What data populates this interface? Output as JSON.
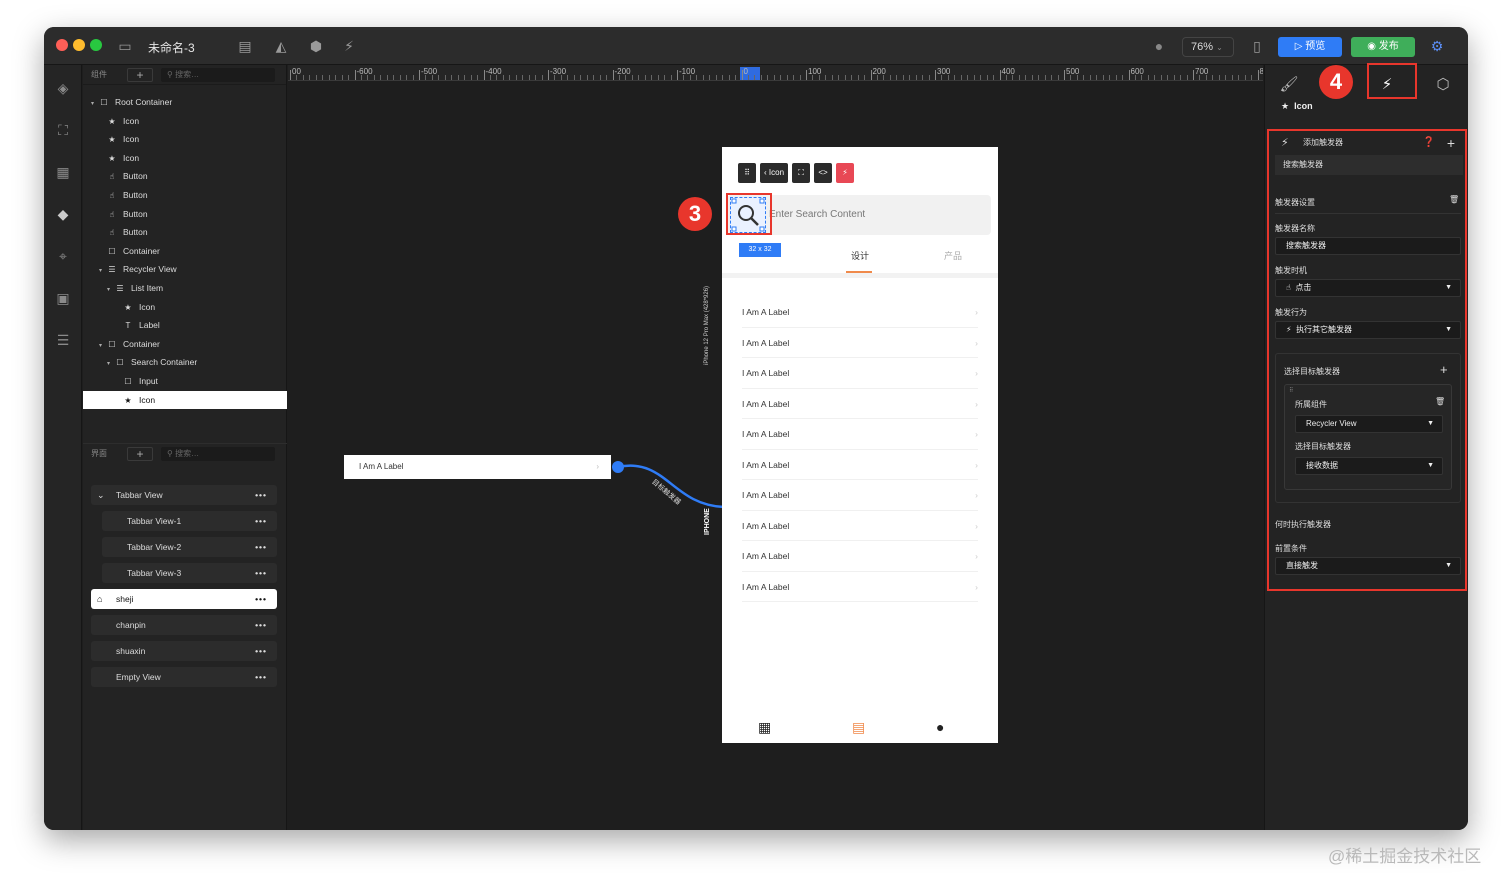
{
  "window": {
    "doc_title": "未命名-3",
    "zoom": "76%",
    "preview_label": "预览",
    "publish_label": "发布"
  },
  "layers_panel": {
    "section_label": "组件",
    "search_placeholder": "搜索",
    "tree": [
      {
        "label": "Root Container",
        "icon": "square-icon",
        "indent": 0,
        "caret": true
      },
      {
        "label": "Icon",
        "icon": "star-icon",
        "indent": 1
      },
      {
        "label": "Icon",
        "icon": "star-icon",
        "indent": 1
      },
      {
        "label": "Icon",
        "icon": "star-icon",
        "indent": 1
      },
      {
        "label": "Button",
        "icon": "hand-icon",
        "indent": 1
      },
      {
        "label": "Button",
        "icon": "hand-icon",
        "indent": 1
      },
      {
        "label": "Button",
        "icon": "hand-icon",
        "indent": 1
      },
      {
        "label": "Button",
        "icon": "hand-icon",
        "indent": 1
      },
      {
        "label": "Container",
        "icon": "square-icon",
        "indent": 1
      },
      {
        "label": "Recycler View",
        "icon": "list-icon",
        "indent": 1,
        "caret": true
      },
      {
        "label": "List Item",
        "icon": "list-icon",
        "indent": 2,
        "caret": true
      },
      {
        "label": "Icon",
        "icon": "star-icon",
        "indent": 3
      },
      {
        "label": "Label",
        "icon": "text-icon",
        "indent": 3
      },
      {
        "label": "Container",
        "icon": "square-icon",
        "indent": 1,
        "caret": true
      },
      {
        "label": "Search Container",
        "icon": "square-icon",
        "indent": 2,
        "caret": true
      },
      {
        "label": "Input",
        "icon": "square-icon",
        "indent": 3
      },
      {
        "label": "Icon",
        "icon": "star-icon",
        "indent": 3,
        "selected": true
      }
    ]
  },
  "pages_panel": {
    "section_label": "界面",
    "search_placeholder": "搜索",
    "items": [
      {
        "label": "Tabbar View",
        "type": "group"
      },
      {
        "label": "Tabbar View-1",
        "type": "sub"
      },
      {
        "label": "Tabbar View-2",
        "type": "sub"
      },
      {
        "label": "Tabbar View-3",
        "type": "sub"
      },
      {
        "label": "sheji",
        "type": "active"
      },
      {
        "label": "chanpin",
        "type": "page"
      },
      {
        "label": "shuaxin",
        "type": "page"
      },
      {
        "label": "Empty View",
        "type": "page"
      }
    ]
  },
  "ruler": {
    "labels": [
      "00",
      "-600",
      "-500",
      "-400",
      "-300",
      "-200",
      "-100",
      "0",
      "100",
      "200",
      "300",
      "400",
      "500",
      "600",
      "700",
      "800"
    ]
  },
  "canvas": {
    "external_label": "I Am A Label",
    "connector_label": "目标触发器",
    "device_name": "iPhone 12 Pro Max (428*926)",
    "device_short": "IPHONE",
    "phone": {
      "toolbar_icon_label": "Icon",
      "search_placeholder": "Enter Search Content",
      "size_badge": "32 x 32",
      "tab_design": "设计",
      "tab_product": "产品",
      "list_items": [
        "I Am A Label",
        "I Am A Label",
        "I Am A Label",
        "I Am A Label",
        "I Am A Label",
        "I Am A Label",
        "I Am A Label",
        "I Am A Label",
        "I Am A Label",
        "I Am A Label"
      ]
    },
    "step_badge_3": "3",
    "step_badge_4": "4"
  },
  "inspector": {
    "selected_name": "Icon",
    "add_trigger": "添加触发器",
    "trigger_title": "搜索触发器",
    "trigger_settings": "触发器设置",
    "trigger_name_label": "触发器名称",
    "trigger_name_value": "搜索触发器",
    "trigger_timing_label": "触发时机",
    "trigger_timing_value": "点击",
    "trigger_action_label": "触发行为",
    "trigger_action_value": "执行其它触发器",
    "target_trigger_label": "选择目标触发器",
    "owner_component_label": "所属组件",
    "owner_component_value": "Recycler View",
    "target_select_label": "选择目标触发器",
    "target_select_value": "接收数据",
    "when_exec_label": "何时执行触发器",
    "precondition_label": "前置条件",
    "precondition_value": "直接触发"
  },
  "watermark": "@稀土掘金技术社区",
  "colors": {
    "accent": "#2f7cf6",
    "highlight": "#e8362c",
    "publish": "#3fae5a",
    "tab_active": "#f08a4b"
  }
}
